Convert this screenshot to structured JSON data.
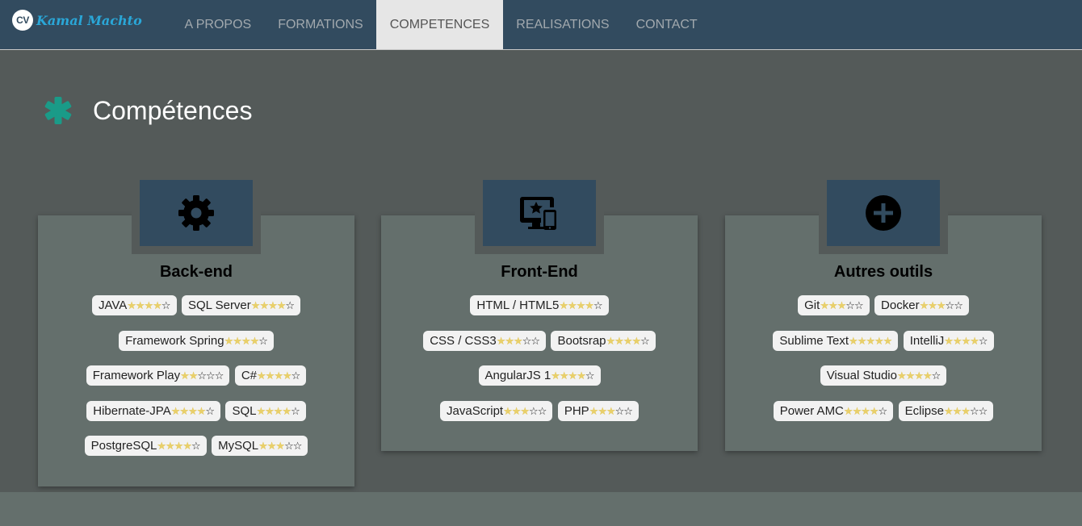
{
  "brand": {
    "badge": "CV",
    "name": "Kamal Machto"
  },
  "nav": [
    {
      "label": "A PROPOS",
      "active": false
    },
    {
      "label": "FORMATIONS",
      "active": false
    },
    {
      "label": "COMPETENCES",
      "active": true
    },
    {
      "label": "REALISATIONS",
      "active": false
    },
    {
      "label": "CONTACT",
      "active": false
    }
  ],
  "section": {
    "title": "Compétences",
    "icon": "asterisk-icon"
  },
  "colors": {
    "navbar": "#324b5f",
    "background": "#545a59",
    "card": "#646f6c",
    "accent": "#1a9b88",
    "star": "#e9d06a"
  },
  "cards": [
    {
      "title": "Back-end",
      "icon": "gear-icon",
      "rows": [
        [
          {
            "name": "JAVA",
            "stars": 4
          },
          {
            "name": "SQL Server",
            "stars": 4
          }
        ],
        [
          {
            "name": "Framework Spring",
            "stars": 4
          }
        ],
        [
          {
            "name": "Framework Play",
            "stars": 2
          },
          {
            "name": "C#",
            "stars": 4
          }
        ],
        [
          {
            "name": "Hibernate-JPA",
            "stars": 4
          },
          {
            "name": "SQL",
            "stars": 4
          }
        ],
        [
          {
            "name": "PostgreSQL",
            "stars": 4
          },
          {
            "name": "MySQL",
            "stars": 3
          }
        ]
      ]
    },
    {
      "title": "Front-End",
      "icon": "desktop-mobile-icon",
      "rows": [
        [
          {
            "name": "HTML / HTML5",
            "stars": 4
          }
        ],
        [
          {
            "name": "CSS / CSS3",
            "stars": 3
          },
          {
            "name": "Bootsrap",
            "stars": 4
          }
        ],
        [
          {
            "name": "AngularJS 1",
            "stars": 4
          }
        ],
        [
          {
            "name": "JavaScript",
            "stars": 3
          },
          {
            "name": "PHP",
            "stars": 3
          }
        ]
      ]
    },
    {
      "title": "Autres outils",
      "icon": "plus-circle-icon",
      "rows": [
        [
          {
            "name": "Git",
            "stars": 3
          },
          {
            "name": "Docker",
            "stars": 3
          }
        ],
        [
          {
            "name": "Sublime Text",
            "stars": 5
          },
          {
            "name": "IntelliJ",
            "stars": 4
          }
        ],
        [
          {
            "name": "Visual Studio",
            "stars": 4
          }
        ],
        [
          {
            "name": "Power AMC",
            "stars": 4
          },
          {
            "name": "Eclipse",
            "stars": 3
          }
        ]
      ]
    }
  ]
}
